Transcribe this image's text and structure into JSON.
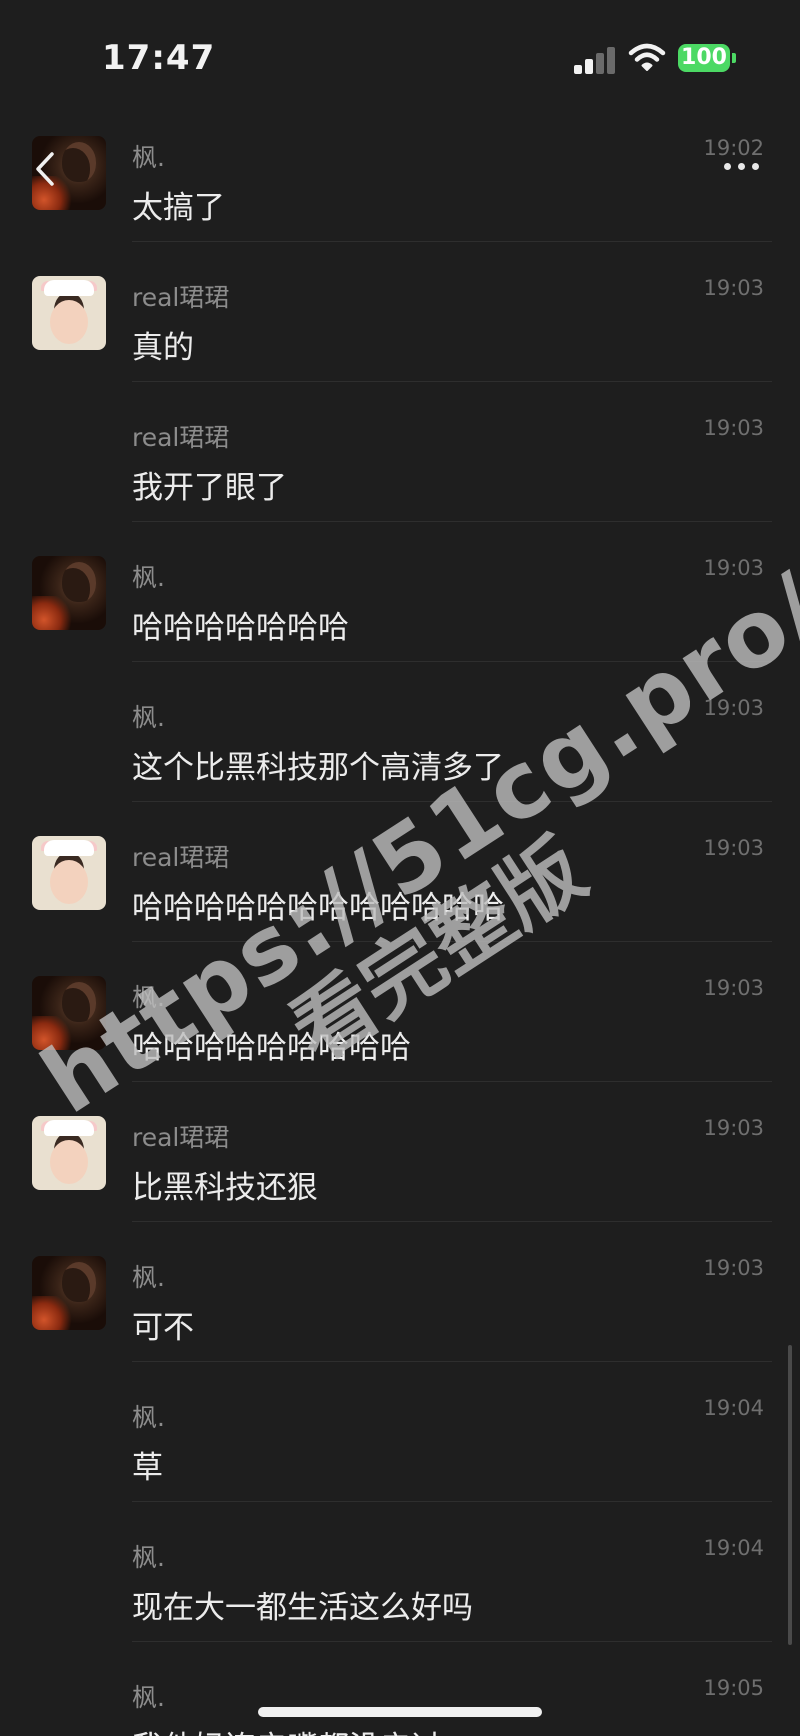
{
  "status_bar": {
    "time": "17:47",
    "battery": "100",
    "battery_color": "#4cd964"
  },
  "nav": {
    "back_icon": "chevron-left-icon",
    "more_icon": "more-horizontal-icon"
  },
  "messages": [
    {
      "sender": "枫.",
      "time": "19:02",
      "text": "太搞了",
      "avatar": "feng"
    },
    {
      "sender": "real珺珺",
      "time": "19:03",
      "text": "真的",
      "avatar": "jun"
    },
    {
      "sender": "real珺珺",
      "time": "19:03",
      "text": "我开了眼了",
      "avatar": ""
    },
    {
      "sender": "枫.",
      "time": "19:03",
      "text": "哈哈哈哈哈哈哈",
      "avatar": "feng"
    },
    {
      "sender": "枫.",
      "time": "19:03",
      "text": "这个比黑科技那个高清多了",
      "avatar": ""
    },
    {
      "sender": "real珺珺",
      "time": "19:03",
      "text": "哈哈哈哈哈哈哈哈哈哈哈哈",
      "avatar": "jun"
    },
    {
      "sender": "枫.",
      "time": "19:03",
      "text": "哈哈哈哈哈哈哈哈哈",
      "avatar": "feng"
    },
    {
      "sender": "real珺珺",
      "time": "19:03",
      "text": "比黑科技还狠",
      "avatar": "jun"
    },
    {
      "sender": "枫.",
      "time": "19:03",
      "text": "可不",
      "avatar": "feng"
    },
    {
      "sender": "枫.",
      "time": "19:04",
      "text": "草",
      "avatar": ""
    },
    {
      "sender": "枫.",
      "time": "19:04",
      "text": "现在大一都生活这么好吗",
      "avatar": ""
    },
    {
      "sender": "枫.",
      "time": "19:05",
      "text": "我他妈连亲嘴都没亲过",
      "avatar": ""
    }
  ],
  "watermark": {
    "url": "https://51cg.pro/",
    "subtitle": "看完整版"
  }
}
